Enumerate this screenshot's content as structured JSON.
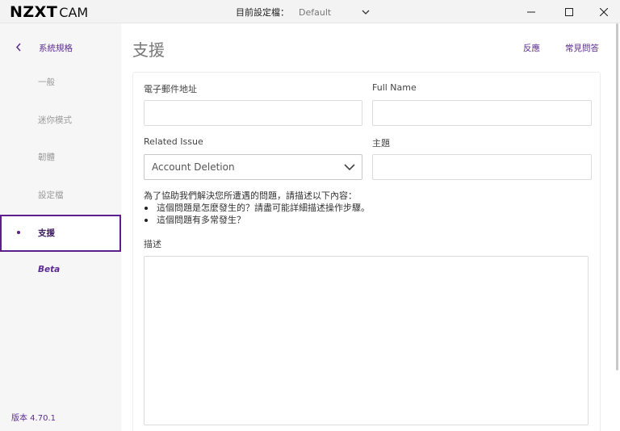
{
  "app": {
    "logo_bold": "NZXT",
    "logo_light": "CAM"
  },
  "titlebar": {
    "profile_label": "目前設定檔：",
    "profile_value": "Default"
  },
  "sidebar": {
    "back_label": "系統規格",
    "items": [
      {
        "label": "一般"
      },
      {
        "label": "迷你模式"
      },
      {
        "label": "韌體"
      },
      {
        "label": "設定檔"
      },
      {
        "label": "支援"
      },
      {
        "label": "Beta"
      }
    ],
    "version": "版本 4.70.1"
  },
  "main": {
    "title": "支援",
    "feedback_link": "反應",
    "faq_link": "常見問答"
  },
  "form": {
    "email_label": "電子郵件地址",
    "email_value": "",
    "name_label": "Full Name",
    "name_value": "",
    "issue_label": "Related Issue",
    "issue_value": "Account Deletion",
    "subject_label": "主題",
    "subject_value": "",
    "instructions_intro": "為了協助我們解決您所遭遇的問題，請描述以下內容：",
    "instructions_items": [
      "這個問題是怎麼發生的？請盡可能詳細描述操作步驟。",
      "這個問題有多常發生？"
    ],
    "description_label": "描述",
    "description_value": ""
  },
  "colors": {
    "accent": "#5c2d91",
    "active_border": "#5c1f8c"
  }
}
